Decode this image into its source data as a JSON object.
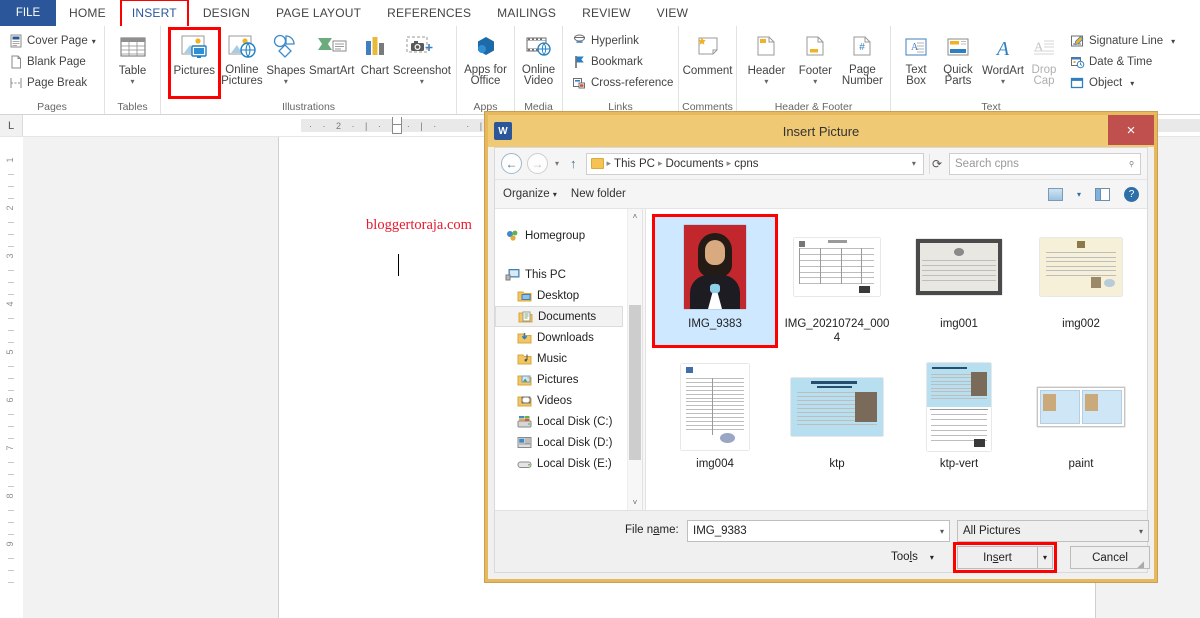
{
  "app": {
    "tabs": [
      {
        "label": "FILE",
        "kind": "file"
      },
      {
        "label": "HOME"
      },
      {
        "label": "INSERT",
        "active": true,
        "highlight": true
      },
      {
        "label": "DESIGN"
      },
      {
        "label": "PAGE LAYOUT"
      },
      {
        "label": "REFERENCES"
      },
      {
        "label": "MAILINGS"
      },
      {
        "label": "REVIEW"
      },
      {
        "label": "VIEW"
      }
    ]
  },
  "ribbon": {
    "groups": {
      "pages": {
        "label": "Pages",
        "items": [
          {
            "label": "Cover Page",
            "caret": true,
            "icon": "cover-page-icon"
          },
          {
            "label": "Blank Page",
            "caret": false,
            "icon": "blank-page-icon"
          },
          {
            "label": "Page Break",
            "caret": false,
            "icon": "page-break-icon"
          }
        ]
      },
      "tables": {
        "label": "Tables",
        "table": "Table"
      },
      "illustrations": {
        "label": "Illustrations",
        "items": [
          {
            "label": "Pictures",
            "caret": false,
            "highlight": true
          },
          {
            "label": "Online Pictures",
            "caret": false
          },
          {
            "label": "Shapes",
            "caret": true
          },
          {
            "label": "SmartArt",
            "caret": false
          },
          {
            "label": "Chart",
            "caret": false
          },
          {
            "label": "Screenshot",
            "caret": true
          }
        ]
      },
      "apps": {
        "label": "Apps",
        "item": "Apps for Office"
      },
      "media": {
        "label": "Media",
        "item": "Online Video"
      },
      "links": {
        "label": "Links",
        "items": [
          {
            "label": "Hyperlink",
            "icon": "hyperlink-icon"
          },
          {
            "label": "Bookmark",
            "icon": "bookmark-icon"
          },
          {
            "label": "Cross-reference",
            "icon": "cross-reference-icon"
          }
        ]
      },
      "comments": {
        "label": "Comments",
        "item": "Comment"
      },
      "headerfooter": {
        "label": "Header & Footer",
        "items": [
          {
            "label": "Header",
            "caret": true
          },
          {
            "label": "Footer",
            "caret": true
          },
          {
            "label": "Page Number",
            "caret": true
          }
        ]
      },
      "text": {
        "label": "Text",
        "big": [
          {
            "label": "Text Box",
            "caret": true
          },
          {
            "label": "Quick Parts",
            "caret": true
          },
          {
            "label": "WordArt",
            "caret": true
          },
          {
            "label": "Drop Cap",
            "caret": true,
            "dim": true
          }
        ],
        "small": [
          {
            "label": "Signature Line",
            "caret": true,
            "icon": "signature-line-icon"
          },
          {
            "label": "Date & Time",
            "caret": false,
            "icon": "date-time-icon"
          },
          {
            "label": "Object",
            "caret": true,
            "icon": "object-icon"
          }
        ]
      }
    }
  },
  "document": {
    "tab_stop_marker": "L",
    "h_ruler_marks": [
      "2",
      "1",
      "1",
      "2"
    ],
    "v_ruler_marks": [
      "1",
      "2",
      "3",
      "4",
      "5",
      "6",
      "7",
      "8",
      "9"
    ],
    "watermark_text": "bloggertoraja.com"
  },
  "dialog": {
    "title": "Insert Picture",
    "close_label": "×",
    "word_icon_label": "W",
    "address": {
      "back_icon": "back-arrow-icon",
      "forward_icon": "forward-arrow-icon",
      "recent_caret": "▾",
      "up_icon": "↑",
      "crumbs": [
        "This PC",
        "Documents",
        "cpns"
      ],
      "dropdown_caret": "▾",
      "refresh_icon": "⟳"
    },
    "search": {
      "placeholder": "Search cpns",
      "icon": "search-icon"
    },
    "toolbar": {
      "organize": "Organize",
      "organize_caret": "▾",
      "new_folder": "New folder",
      "view_icon": "view-layout-icon",
      "view_caret": "▾",
      "pane_icon": "preview-pane-icon",
      "help_icon": "help-icon",
      "help_glyph": "?"
    },
    "nav_pane": {
      "items": [
        {
          "label": "Homegroup",
          "icon": "homegroup-icon",
          "indent": false,
          "selected": false,
          "spacer_after": true
        },
        {
          "label": "This PC",
          "icon": "this-pc-icon",
          "indent": false,
          "selected": false
        },
        {
          "label": "Desktop",
          "icon": "desktop-folder-icon",
          "indent": true,
          "selected": false
        },
        {
          "label": "Documents",
          "icon": "documents-folder-icon",
          "indent": true,
          "selected": true
        },
        {
          "label": "Downloads",
          "icon": "downloads-folder-icon",
          "indent": true,
          "selected": false
        },
        {
          "label": "Music",
          "icon": "music-folder-icon",
          "indent": true,
          "selected": false
        },
        {
          "label": "Pictures",
          "icon": "pictures-folder-icon",
          "indent": true,
          "selected": false
        },
        {
          "label": "Videos",
          "icon": "videos-folder-icon",
          "indent": true,
          "selected": false
        },
        {
          "label": "Local Disk (C:)",
          "icon": "drive-c-icon",
          "indent": true,
          "selected": false
        },
        {
          "label": "Local Disk (D:)",
          "icon": "drive-d-icon",
          "indent": true,
          "selected": false
        },
        {
          "label": "Local Disk (E:)",
          "icon": "drive-e-icon",
          "indent": true,
          "selected": false
        }
      ]
    },
    "files": [
      {
        "name": "IMG_9383",
        "thumb": "portrait",
        "selected": true
      },
      {
        "name": "IMG_20210724_0004",
        "thumb": "form",
        "selected": false
      },
      {
        "name": "img001",
        "thumb": "cert",
        "selected": false
      },
      {
        "name": "img002",
        "thumb": "cert2",
        "selected": false
      },
      {
        "name": "img004",
        "thumb": "list",
        "selected": false
      },
      {
        "name": "ktp",
        "thumb": "ktp",
        "selected": false
      },
      {
        "name": "ktp-vert",
        "thumb": "ktpv",
        "selected": false
      },
      {
        "name": "paint",
        "thumb": "paint",
        "selected": false
      }
    ],
    "footer": {
      "file_name_label": "File name:",
      "file_name_value": "IMG_9383",
      "file_type_value": "All Pictures",
      "tools_label": "Tools",
      "tools_caret": "▾",
      "insert_label": "Insert",
      "insert_caret": "▾",
      "cancel_label": "Cancel",
      "dropdown_caret": "▾"
    }
  },
  "colors": {
    "word_blue": "#2b579a",
    "highlight_red": "#ff0000",
    "dialog_gold": "#f0c975",
    "selection_blue": "#cde8ff",
    "watermark_red": "#e8192c"
  }
}
